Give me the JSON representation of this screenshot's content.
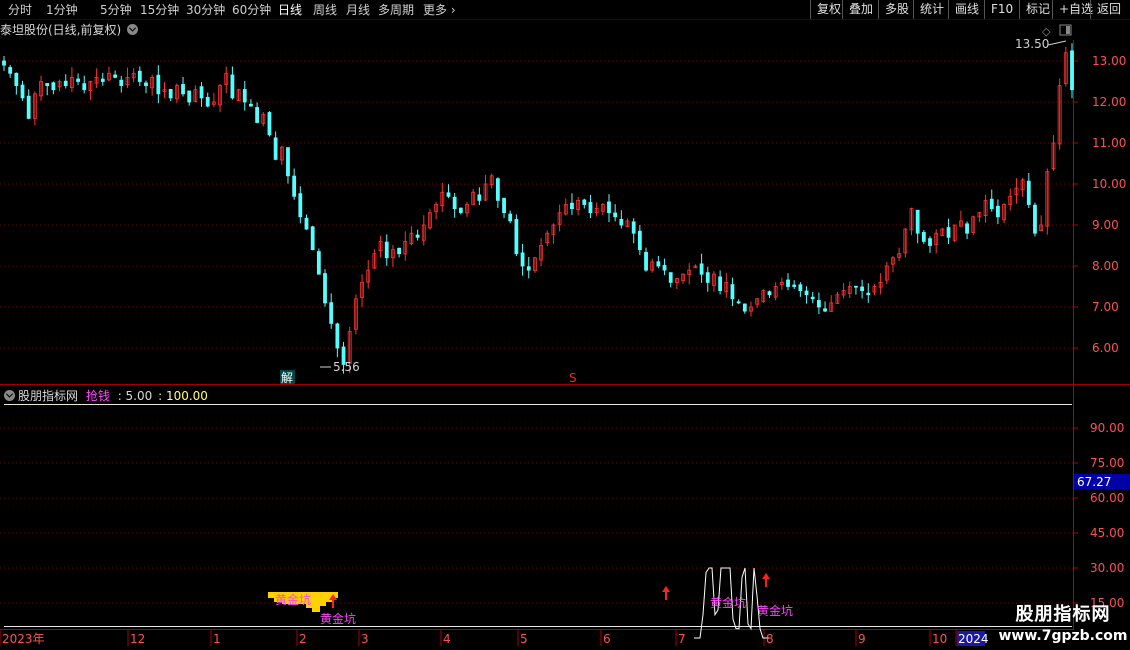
{
  "toolbar": {
    "periods": [
      "分时",
      "1分钟",
      "5分钟",
      "15分钟",
      "30分钟",
      "60分钟",
      "日线",
      "周线",
      "月线",
      "多周期",
      "更多"
    ],
    "active_period": "日线",
    "right_buttons": [
      "复权",
      "叠加",
      "多股",
      "统计",
      "画线",
      "F10",
      "标记",
      "+自选",
      "返回"
    ]
  },
  "stock": {
    "title": "泰坦股份(日线,前复权)"
  },
  "indicator": {
    "name": "股朋指标网",
    "series_label": "抢钱",
    "param1": ": 5.00",
    "param2": ": 100.00"
  },
  "watermark": {
    "title": "股朋指标网",
    "url": "www.7gpzb.com"
  },
  "colors": {
    "up": "#ff3232",
    "down": "#54ffff",
    "gridline": "#7a0000",
    "axis": "#b00000",
    "gold": "#ffd000",
    "magenta": "#ff44ff"
  },
  "chart_data": [
    {
      "type": "candlestick",
      "title": "泰坦股份(日线,前复权)",
      "ylim": [
        5.2,
        13.9
      ],
      "y_ticks": [
        "13.00",
        "12.00",
        "11.00",
        "10.00",
        "9.00",
        "8.00",
        "7.00",
        "6.00"
      ],
      "x_ticks": [
        "2023年",
        "12",
        "1",
        "2",
        "3",
        "4",
        "5",
        "6",
        "7",
        "8",
        "9",
        "10",
        "2024"
      ],
      "annotations": {
        "high_label": "13.50",
        "low_label": "5.56",
        "markers": [
          "解",
          "S"
        ]
      },
      "close_path": [
        12.9,
        12.7,
        12.4,
        12.1,
        11.6,
        12.2,
        12.5,
        12.4,
        12.3,
        12.5,
        12.4,
        12.6,
        12.5,
        12.3,
        12.5,
        12.6,
        12.5,
        12.7,
        12.6,
        12.4,
        12.6,
        12.7,
        12.5,
        12.4,
        12.6,
        12.2,
        12.3,
        12.1,
        12.4,
        12.2,
        12.0,
        12.3,
        12.1,
        11.9,
        12.0,
        12.4,
        12.7,
        12.1,
        12.3,
        12.0,
        11.9,
        11.5,
        11.7,
        11.2,
        10.6,
        10.9,
        10.2,
        9.7,
        9.2,
        8.9,
        8.4,
        7.8,
        7.1,
        6.6,
        6.0,
        5.6,
        6.4,
        7.2,
        7.6,
        7.9,
        8.3,
        8.6,
        8.2,
        8.4,
        8.3,
        8.6,
        8.8,
        8.7,
        9.0,
        9.3,
        9.5,
        9.8,
        9.7,
        9.4,
        9.3,
        9.5,
        9.8,
        9.6,
        10.0,
        10.2,
        9.6,
        9.3,
        9.1,
        8.3,
        8.0,
        7.9,
        8.2,
        8.5,
        8.8,
        9.0,
        9.3,
        9.5,
        9.4,
        9.6,
        9.5,
        9.3,
        9.4,
        9.5,
        9.3,
        9.2,
        9.0,
        9.1,
        8.8,
        8.4,
        7.9,
        8.1,
        8.0,
        7.9,
        7.6,
        7.7,
        7.8,
        7.9,
        8.0,
        7.8,
        7.6,
        7.8,
        7.4,
        7.6,
        7.2,
        7.1,
        6.9,
        7.0,
        7.2,
        7.4,
        7.3,
        7.5,
        7.6,
        7.5,
        7.5,
        7.4,
        7.3,
        7.2,
        7.0,
        6.9,
        7.1,
        7.3,
        7.4,
        7.5,
        7.5,
        7.4,
        7.3,
        7.5,
        7.6,
        8.0,
        8.2,
        8.3,
        8.9,
        9.4,
        8.8,
        8.6,
        8.5,
        8.8,
        8.9,
        8.7,
        9.0,
        9.1,
        8.8,
        9.2,
        9.3,
        9.6,
        9.4,
        9.2,
        9.5,
        9.7,
        9.9,
        10.1,
        9.5,
        8.8,
        9.0,
        10.3,
        11.0,
        12.4,
        13.2,
        12.3
      ]
    },
    {
      "type": "indicator",
      "title": "股朋指标网",
      "ylim": [
        0,
        102
      ],
      "y_ticks": [
        "90.00",
        "75.00",
        "60.00",
        "45.00",
        "30.00",
        "15.00"
      ],
      "current_value": "67.27",
      "labels": [
        "黄金坑",
        "黄金坑",
        "黄金坑",
        "黄金坑"
      ],
      "white_line": [
        0,
        0,
        0,
        10,
        28,
        30,
        30,
        10,
        12,
        30,
        30,
        30,
        30,
        8,
        4,
        4,
        26,
        30,
        6,
        4,
        30,
        18,
        4,
        0,
        0,
        0
      ]
    }
  ]
}
